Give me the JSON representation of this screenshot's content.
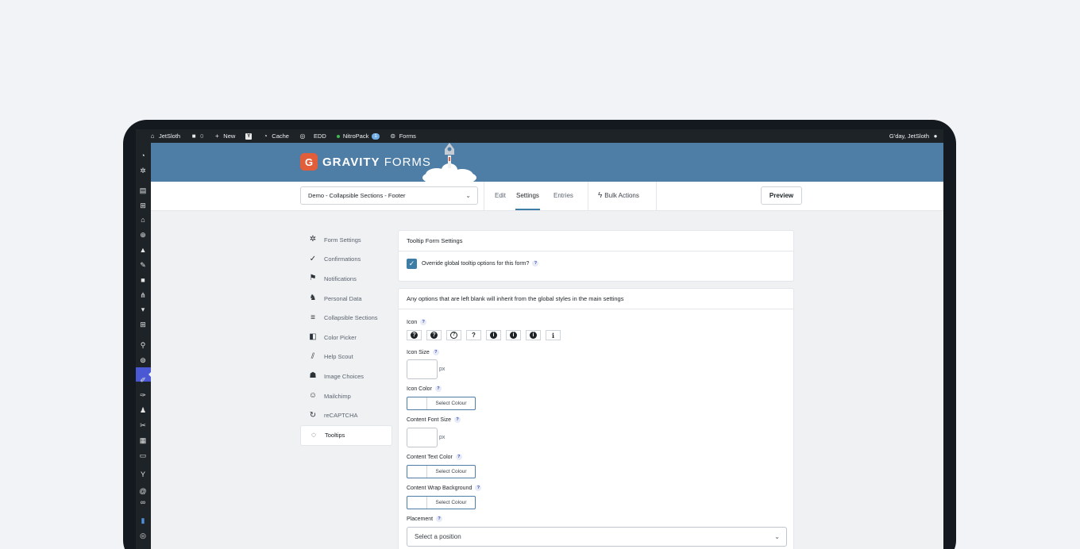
{
  "adminbar": {
    "site": "JetSloth",
    "comments_count": "0",
    "new": "New",
    "cache": "Cache",
    "edd": "EDD",
    "nitropack": "NitroPack",
    "nitropack_badge": "1",
    "forms": "Forms",
    "greeting": "G'day, JetSloth"
  },
  "header": {
    "logo_g": "G",
    "logo_bold": "GRAVITY",
    "logo_light": "FORMS"
  },
  "toolbar": {
    "form_selected": "Demo - Collapsible Sections - Footer",
    "tabs": [
      "Edit",
      "Settings",
      "Entries"
    ],
    "active_tab": "Settings",
    "bulk_actions": "Bulk Actions",
    "preview": "Preview"
  },
  "settings_nav": [
    {
      "label": "Form Settings",
      "icon": "gear-icon"
    },
    {
      "label": "Confirmations",
      "icon": "check-circle-icon"
    },
    {
      "label": "Notifications",
      "icon": "flag-icon"
    },
    {
      "label": "Personal Data",
      "icon": "people-icon"
    },
    {
      "label": "Collapsible Sections",
      "icon": "sections-icon"
    },
    {
      "label": "Color Picker",
      "icon": "color-picker-icon"
    },
    {
      "label": "Help Scout",
      "icon": "helpscout-icon"
    },
    {
      "label": "Image Choices",
      "icon": "image-choices-icon"
    },
    {
      "label": "Mailchimp",
      "icon": "mailchimp-icon"
    },
    {
      "label": "reCAPTCHA",
      "icon": "recaptcha-icon"
    },
    {
      "label": "Tooltips",
      "icon": "tooltip-icon"
    }
  ],
  "tooltip_panel": {
    "title": "Tooltip Form Settings",
    "override_label": "Override global tooltip options for this form?",
    "override_checked": true
  },
  "options_panel": {
    "title": "Any options that are left blank will inherit from the global styles in the main settings",
    "icon_label": "Icon",
    "icon_choices": [
      "?",
      "?",
      "?",
      "?",
      "i",
      "i",
      "i",
      "i"
    ],
    "icon_size_label": "Icon Size",
    "icon_size_unit": "px",
    "icon_color_label": "Icon Color",
    "select_colour": "Select Colour",
    "content_font_size_label": "Content Font Size",
    "content_font_size_unit": "px",
    "content_text_color_label": "Content Text Color",
    "content_wrap_bg_label": "Content Wrap Background",
    "placement_label": "Placement",
    "placement_placeholder": "Select a position",
    "help_glyph": "?"
  },
  "colors": {
    "header_bg": "#4e7da6",
    "admin_bar": "#1d2327",
    "active_menu": "#4a58d4",
    "brand_orange": "#e25d3a"
  }
}
